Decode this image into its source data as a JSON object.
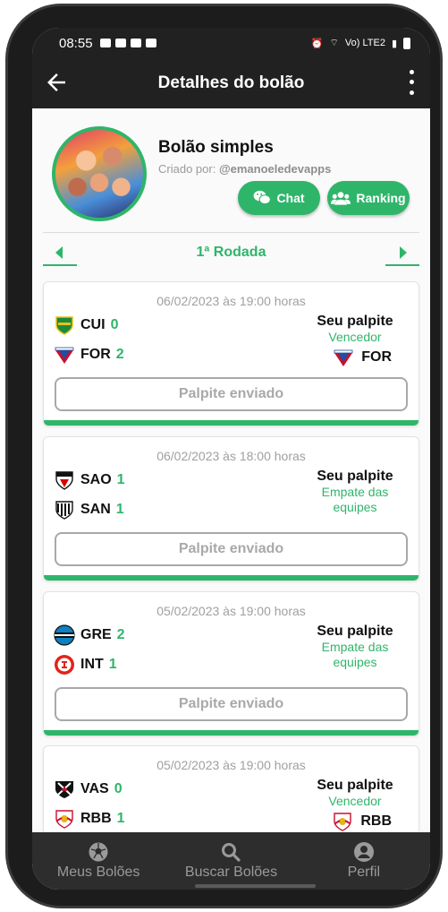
{
  "status_bar": {
    "time": "08:55",
    "network": "Vo) LTE2"
  },
  "app_bar": {
    "title": "Detalhes do bolão"
  },
  "pool": {
    "name": "Bolão simples",
    "created_by_label": "Criado por:",
    "creator": "@emanoeledevapps",
    "chat_label": "Chat",
    "ranking_label": "Ranking"
  },
  "round": {
    "label": "1ª Rodada"
  },
  "guess_title": "Seu palpite",
  "sent_label": "Palpite enviado",
  "matches": [
    {
      "date": "06/02/2023 às 19:00 horas",
      "home": {
        "code": "CUI",
        "score": "0"
      },
      "away": {
        "code": "FOR",
        "score": "2"
      },
      "guess": "Vencedor",
      "guess_team": "FOR"
    },
    {
      "date": "06/02/2023 às 18:00 horas",
      "home": {
        "code": "SAO",
        "score": "1"
      },
      "away": {
        "code": "SAN",
        "score": "1"
      },
      "guess": "Empate das equipes",
      "guess_team": ""
    },
    {
      "date": "05/02/2023 às 19:00 horas",
      "home": {
        "code": "GRE",
        "score": "2"
      },
      "away": {
        "code": "INT",
        "score": "1"
      },
      "guess": "Empate das equipes",
      "guess_team": ""
    },
    {
      "date": "05/02/2023 às 19:00 horas",
      "home": {
        "code": "VAS",
        "score": "0"
      },
      "away": {
        "code": "RBB",
        "score": "1"
      },
      "guess": "Vencedor",
      "guess_team": "RBB"
    }
  ],
  "bottom_nav": {
    "items": [
      {
        "label": "Meus Bolões",
        "icon": "soccer-ball-icon"
      },
      {
        "label": "Buscar Bolões",
        "icon": "search-icon"
      },
      {
        "label": "Perfil",
        "icon": "user-icon"
      }
    ]
  },
  "colors": {
    "accent": "#2fb56a",
    "bar": "#212121",
    "nav": "#2d2d2d"
  }
}
